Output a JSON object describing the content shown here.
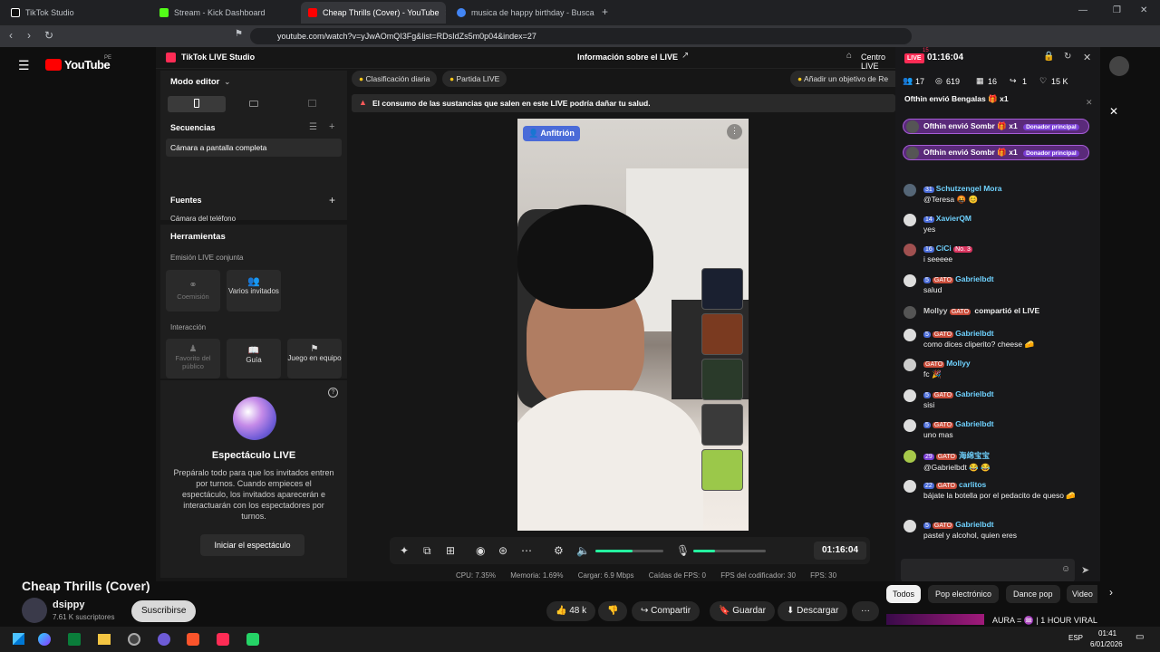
{
  "browser": {
    "tabs": [
      {
        "label": "TikTok Studio",
        "color": "#111111"
      },
      {
        "label": "Stream - Kick Dashboard",
        "color": "#53fc18"
      },
      {
        "label": "Cheap Thrills (Cover) - YouTube",
        "color": "#ff0000"
      },
      {
        "label": "musica de happy birthday - Buscar c",
        "color": "#4285f4"
      }
    ],
    "new_tab": "+",
    "url": "youtube.com/watch?v=yJwAOmQI3Fg&list=RDsIdZs5m0p04&index=27"
  },
  "youtube": {
    "logo": "YouTube",
    "region": "PE",
    "video_title": "Cheap Thrills (Cover)",
    "channel": "dsippy",
    "subscribers": "7.61 K suscriptores",
    "subscribe": "Suscribirse",
    "likes": "48 k",
    "share": "Compartir",
    "save": "Guardar",
    "download": "Descargar",
    "more": "···",
    "filters": [
      "Todos",
      "Pop electrónico",
      "Dance pop",
      "Video"
    ],
    "side_title": "AURA = ♒ | 1 HOUR VIRAL"
  },
  "studio": {
    "title": "TikTok LIVE Studio",
    "header_center": "Información sobre el LIVE",
    "centro": "Centro LIVE",
    "mode": "Modo editor",
    "sequences": "Secuencias",
    "sequence_item": "Cámara a pantalla completa",
    "sources": "Fuentes",
    "source_item": "Cámara del teléfono",
    "tools": "Herramientas",
    "cohost_section": "Emisión LIVE conjunta",
    "cohost": "Coemisión",
    "multi": "Varios invitados",
    "interaction": "Interacción",
    "fav": "Favorito del público",
    "guide": "Guía",
    "group_game": "Juego en equipo",
    "show_title": "Espectáculo LIVE",
    "show_desc": "Prepáralo todo para que los invitados entren por turnos. Cuando empieces el espectáculo, los invitados aparecerán e interactuarán con los espectadores por turnos.",
    "show_button": "Iniciar el espectáculo",
    "chip1": "Clasificación diaria",
    "chip2": "Partida LIVE",
    "chip3": "Añadir un objetivo de Re",
    "warning": "El consumo de las sustancias que salen en este LIVE podría dañar tu salud.",
    "host_badge": "Anfitrión",
    "timer": "01:16:04",
    "stats": {
      "cpu": "CPU: 7.35%",
      "mem": "Memoria: 1.69%",
      "upload": "Cargar: 6.9 Mbps",
      "drops": "Caídas de FPS: 0",
      "enc": "FPS del codificador: 30",
      "fps": "FPS: 30"
    }
  },
  "chat": {
    "live": "LIVE",
    "live_count": "15",
    "timer": "01:16:04",
    "viewers": "17",
    "views": "619",
    "calendar": "16",
    "shares": "1",
    "likes": "15 K",
    "gift1": "Ofthin envió Bengalas",
    "gift_mult": "x1",
    "gift2": "Ofthin envió Sombr",
    "gift3": "Ofthin envió Sombr",
    "donor": "Donador principal",
    "messages": [
      {
        "lvl": "31",
        "user": "Schutzengel Mora",
        "text": "@Teresa 🤬 😊",
        "gato": false,
        "avcolor": "#556677"
      },
      {
        "lvl": "14",
        "user": "XavierQM",
        "text": "yes",
        "gato": false,
        "avcolor": "#ddd"
      },
      {
        "lvl": "16",
        "user": "CiCi",
        "text": "i seeeee",
        "gato": false,
        "avcolor": "#a05050",
        "extra": "No. 3"
      },
      {
        "lvl": "5",
        "user": "Gabrielbdt",
        "text": "salud",
        "gato": true,
        "avcolor": "#ddd"
      },
      {
        "lvl": "",
        "user": "Mollyy",
        "text": "compartió el LIVE",
        "gato": true,
        "avcolor": "#555"
      },
      {
        "lvl": "5",
        "user": "Gabrielbdt",
        "text": "como dices cliperito? cheese 🧀",
        "gato": true,
        "avcolor": "#ddd"
      },
      {
        "lvl": "",
        "user": "Mollyy",
        "text": "fc 🎉",
        "gato": true,
        "avcolor": "#ccc"
      },
      {
        "lvl": "5",
        "user": "Gabrielbdt",
        "text": "sisi",
        "gato": true,
        "avcolor": "#ddd"
      },
      {
        "lvl": "5",
        "user": "Gabrielbdt",
        "text": "uno mas",
        "gato": true,
        "avcolor": "#ddd"
      },
      {
        "lvl": "29",
        "user": "海绵宝宝",
        "text": "@Gabrielbdt 😂 😂",
        "gato": true,
        "avcolor": "#a6c84a"
      },
      {
        "lvl": "22",
        "user": "carlitos",
        "text": "bájate la botella por el pedacito de queso 🧀",
        "gato": true,
        "avcolor": "#ddd"
      },
      {
        "lvl": "5",
        "user": "Gabrielbdt",
        "text": "pastel y alcohol, quien eres",
        "gato": true,
        "avcolor": "#ddd"
      }
    ]
  },
  "taskbar": {
    "time": "01:41",
    "date": "6/01/2026",
    "lang": "ESP"
  }
}
